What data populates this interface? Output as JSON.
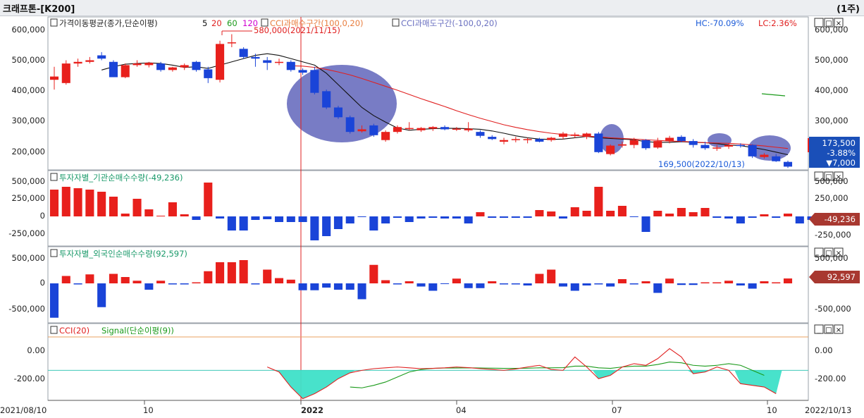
{
  "window": {
    "title": "크래프톤-[K200]",
    "period": "(1주)",
    "pane_buttons": [
      "_",
      "□",
      "×"
    ]
  },
  "price_pane": {
    "legend_prefix": "가격이동평균(종가,단순이평)",
    "ma_periods": [
      "5",
      "20",
      "60",
      "120"
    ],
    "ma_colors": [
      "#111111",
      "#e02020",
      "#1a9a1a",
      "#d000d0"
    ],
    "legend_cci_over": "CCI과매수구간(100,0,20)",
    "legend_cci_under": "CCI과매도구간(-100,0,20)",
    "hc_label": "HC:-70.09%",
    "lc_label": "LC:2.36%",
    "high_annotation": "580,000(2021/11/15)",
    "low_annotation": "169,500(2022/10/13)",
    "y_labels": [
      "600,000",
      "500,000",
      "400,000",
      "300,000",
      "200,000"
    ],
    "right_y_labels": [
      "600,000",
      "500,000",
      "400,000",
      "300,000",
      "200,000"
    ],
    "current_price": "173,500",
    "change_pct": "-3.88%",
    "change_amount": "▼7,000"
  },
  "inst_pane": {
    "legend": "투자자별_기관순매수수량(-49,236)",
    "y_labels": [
      "500,000",
      "250,000",
      "0",
      "-250,000"
    ],
    "right_y_labels": [
      "500,000",
      "250,000",
      "0",
      "-250,000"
    ],
    "current_value": "-49,236"
  },
  "foreign_pane": {
    "legend": "투자자별_외국인순매수수량(92,597)",
    "y_labels": [
      "500,000",
      "0",
      "-500,000"
    ],
    "right_y_labels": [
      "500,000",
      "0",
      "-500,000"
    ],
    "current_value": "92,597"
  },
  "cci_pane": {
    "legend_cci": "CCI(20)",
    "legend_signal": "Signal(단순이평(9))",
    "y_labels": [
      "0.00",
      "-200.00"
    ],
    "right_y_labels": [
      "0.00",
      "-200.00"
    ]
  },
  "x_axis": {
    "labels": [
      "2021/08/10",
      "10",
      "2022",
      "04",
      "07",
      "10",
      "2022/10/13"
    ]
  },
  "colors": {
    "up": "#e8201c",
    "down": "#1a44d8",
    "ma20": "#e02020",
    "ma5": "#111111",
    "cci": "#e02020",
    "signal": "#1a9a1a",
    "cci_fill": "#3ee0c8",
    "highlight_ellipse": "#5a5fb8",
    "cursor_line": "#e02020"
  },
  "chart_data": [
    {
      "type": "candlestick",
      "title": "크래프톤-[K200]",
      "x_label": "week",
      "ylim": [
        170000,
        620000
      ],
      "candles": [
        {
          "o": 440000,
          "h": 480000,
          "l": 410000,
          "c": 450000
        },
        {
          "o": 430000,
          "h": 500000,
          "l": 425000,
          "c": 490000
        },
        {
          "o": 490000,
          "h": 505000,
          "l": 480000,
          "c": 495000
        },
        {
          "o": 495000,
          "h": 510000,
          "l": 490000,
          "c": 500000
        },
        {
          "o": 515000,
          "h": 525000,
          "l": 500000,
          "c": 505000
        },
        {
          "o": 495000,
          "h": 500000,
          "l": 450000,
          "c": 448000
        },
        {
          "o": 448000,
          "h": 490000,
          "l": 445000,
          "c": 485000
        },
        {
          "o": 485000,
          "h": 500000,
          "l": 480000,
          "c": 490000
        },
        {
          "o": 485000,
          "h": 495000,
          "l": 478000,
          "c": 492000
        },
        {
          "o": 490000,
          "h": 495000,
          "l": 465000,
          "c": 470000
        },
        {
          "o": 470000,
          "h": 480000,
          "l": 465000,
          "c": 478000
        },
        {
          "o": 478000,
          "h": 490000,
          "l": 470000,
          "c": 485000
        },
        {
          "o": 495000,
          "h": 498000,
          "l": 465000,
          "c": 470000
        },
        {
          "o": 472000,
          "h": 480000,
          "l": 430000,
          "c": 445000
        },
        {
          "o": 440000,
          "h": 560000,
          "l": 432000,
          "c": 550000
        },
        {
          "o": 555000,
          "h": 580000,
          "l": 540000,
          "c": 555000
        },
        {
          "o": 535000,
          "h": 540000,
          "l": 505000,
          "c": 510000
        },
        {
          "o": 510000,
          "h": 520000,
          "l": 480000,
          "c": 505000
        },
        {
          "o": 500000,
          "h": 510000,
          "l": 470000,
          "c": 492000
        },
        {
          "o": 492000,
          "h": 505000,
          "l": 485000,
          "c": 495000
        },
        {
          "o": 495000,
          "h": 500000,
          "l": 465000,
          "c": 470000
        },
        {
          "o": 470000,
          "h": 475000,
          "l": 455000,
          "c": 462000
        },
        {
          "o": 470000,
          "h": 480000,
          "l": 395000,
          "c": 400000
        },
        {
          "o": 405000,
          "h": 410000,
          "l": 350000,
          "c": 355000
        },
        {
          "o": 355000,
          "h": 360000,
          "l": 320000,
          "c": 325000
        },
        {
          "o": 325000,
          "h": 330000,
          "l": 275000,
          "c": 280000
        },
        {
          "o": 282000,
          "h": 300000,
          "l": 278000,
          "c": 288000
        },
        {
          "o": 300000,
          "h": 305000,
          "l": 265000,
          "c": 270000
        },
        {
          "o": 255000,
          "h": 285000,
          "l": 250000,
          "c": 280000
        },
        {
          "o": 280000,
          "h": 300000,
          "l": 275000,
          "c": 295000
        },
        {
          "o": 290000,
          "h": 310000,
          "l": 285000,
          "c": 292000
        },
        {
          "o": 285000,
          "h": 295000,
          "l": 280000,
          "c": 292000
        },
        {
          "o": 290000,
          "h": 298000,
          "l": 283000,
          "c": 295000
        },
        {
          "o": 295000,
          "h": 300000,
          "l": 285000,
          "c": 288000
        },
        {
          "o": 288000,
          "h": 295000,
          "l": 283000,
          "c": 290000
        },
        {
          "o": 285000,
          "h": 310000,
          "l": 280000,
          "c": 290000
        },
        {
          "o": 280000,
          "h": 285000,
          "l": 262000,
          "c": 268000
        },
        {
          "o": 265000,
          "h": 270000,
          "l": 255000,
          "c": 258000
        },
        {
          "o": 250000,
          "h": 262000,
          "l": 242000,
          "c": 255000
        },
        {
          "o": 255000,
          "h": 265000,
          "l": 248000,
          "c": 258000
        },
        {
          "o": 255000,
          "h": 262000,
          "l": 245000,
          "c": 258000
        },
        {
          "o": 258000,
          "h": 262000,
          "l": 248000,
          "c": 250000
        },
        {
          "o": 255000,
          "h": 265000,
          "l": 250000,
          "c": 262000
        },
        {
          "o": 265000,
          "h": 280000,
          "l": 258000,
          "c": 275000
        },
        {
          "o": 268000,
          "h": 278000,
          "l": 262000,
          "c": 272000
        },
        {
          "o": 265000,
          "h": 278000,
          "l": 258000,
          "c": 275000
        },
        {
          "o": 275000,
          "h": 280000,
          "l": 215000,
          "c": 218000
        },
        {
          "o": 212000,
          "h": 242000,
          "l": 208000,
          "c": 238000
        },
        {
          "o": 238000,
          "h": 250000,
          "l": 232000,
          "c": 242000
        },
        {
          "o": 240000,
          "h": 262000,
          "l": 230000,
          "c": 255000
        },
        {
          "o": 255000,
          "h": 258000,
          "l": 225000,
          "c": 230000
        },
        {
          "o": 232000,
          "h": 262000,
          "l": 228000,
          "c": 252000
        },
        {
          "o": 252000,
          "h": 268000,
          "l": 245000,
          "c": 262000
        },
        {
          "o": 265000,
          "h": 270000,
          "l": 248000,
          "c": 252000
        },
        {
          "o": 252000,
          "h": 258000,
          "l": 232000,
          "c": 240000
        },
        {
          "o": 240000,
          "h": 250000,
          "l": 225000,
          "c": 230000
        },
        {
          "o": 230000,
          "h": 240000,
          "l": 222000,
          "c": 232000
        },
        {
          "o": 235000,
          "h": 245000,
          "l": 228000,
          "c": 240000
        },
        {
          "o": 240000,
          "h": 245000,
          "l": 232000,
          "c": 238000
        },
        {
          "o": 240000,
          "h": 242000,
          "l": 200000,
          "c": 205000
        },
        {
          "o": 203000,
          "h": 215000,
          "l": 198000,
          "c": 210000
        },
        {
          "o": 205000,
          "h": 212000,
          "l": 188000,
          "c": 190000
        },
        {
          "o": 188000,
          "h": 192000,
          "l": 169500,
          "c": 173500
        }
      ],
      "series": [
        {
          "name": "5",
          "values": [
            null,
            null,
            null,
            null,
            470000,
            480000,
            488000,
            490000,
            492000,
            490000,
            485000,
            478000,
            480000,
            475000,
            485000,
            495000,
            505000,
            515000,
            520000,
            515000,
            505000,
            495000,
            485000,
            460000,
            425000,
            390000,
            355000,
            330000,
            310000,
            292000,
            285000,
            288000,
            290000,
            291000,
            291000,
            290000,
            288000,
            283000,
            276000,
            268000,
            262000,
            258000,
            257000,
            258000,
            262000,
            266000,
            262000,
            260000,
            258000,
            256000,
            250000,
            248000,
            248000,
            250000,
            248000,
            247000,
            244000,
            240000,
            238000,
            232000,
            226000,
            218000,
            210000
          ]
        },
        {
          "name": "20",
          "values": [
            null,
            null,
            null,
            null,
            null,
            null,
            null,
            null,
            null,
            null,
            null,
            null,
            null,
            null,
            null,
            null,
            null,
            null,
            null,
            null,
            483000,
            482000,
            478000,
            472000,
            464000,
            455000,
            444000,
            432000,
            420000,
            408000,
            395000,
            382000,
            370000,
            358000,
            345000,
            333000,
            322000,
            312000,
            302000,
            294000,
            287000,
            281000,
            276000,
            272000,
            269000,
            267000,
            265000,
            262000,
            260000,
            258000,
            256000,
            254000,
            252000,
            251000,
            249000,
            247000,
            246000,
            245000,
            243000,
            240000,
            237000,
            233000,
            229000
          ]
        }
      ],
      "annotations": [
        "580,000(2021/11/15)",
        "169,500(2022/10/13)",
        "HC:-70.09%",
        "LC:2.36%"
      ]
    },
    {
      "type": "bar",
      "title": "투자자별_기관순매수수량(-49,236)",
      "ylim": [
        -350000,
        600000
      ],
      "values": [
        380000,
        420000,
        400000,
        380000,
        350000,
        280000,
        40000,
        250000,
        100000,
        10000,
        200000,
        30000,
        -50000,
        480000,
        -30000,
        -200000,
        -200000,
        -50000,
        -40000,
        -80000,
        -80000,
        -80000,
        -340000,
        -280000,
        -180000,
        -100000,
        -10000,
        -200000,
        -100000,
        -20000,
        -80000,
        -30000,
        -20000,
        -30000,
        -30000,
        -100000,
        60000,
        -20000,
        -20000,
        -20000,
        -20000,
        90000,
        70000,
        -30000,
        130000,
        80000,
        420000,
        80000,
        150000,
        -10000,
        -220000,
        80000,
        40000,
        120000,
        60000,
        120000,
        -20000,
        -30000,
        -100000,
        -20000,
        30000,
        -20000,
        40000,
        -100000,
        -49236
      ]
    },
    {
      "type": "bar",
      "title": "투자자별_외국인순매수수량(92,597)",
      "ylim": [
        -700000,
        600000
      ],
      "values": [
        -650000,
        140000,
        -20000,
        170000,
        -450000,
        180000,
        120000,
        50000,
        -120000,
        50000,
        -20000,
        -20000,
        20000,
        230000,
        400000,
        400000,
        440000,
        -20000,
        260000,
        100000,
        70000,
        -130000,
        -130000,
        -80000,
        -120000,
        -120000,
        -300000,
        350000,
        60000,
        -20000,
        40000,
        -60000,
        -140000,
        -10000,
        90000,
        -90000,
        -90000,
        40000,
        -20000,
        -20000,
        -40000,
        180000,
        260000,
        -60000,
        -140000,
        -40000,
        -20000,
        -60000,
        80000,
        -20000,
        40000,
        -180000,
        90000,
        -30000,
        -30000,
        20000,
        20000,
        50000,
        -40000,
        -100000,
        40000,
        20000,
        92597
      ]
    },
    {
      "type": "line",
      "title": "CCI(20) Signal(단순이평(9))",
      "ylim": [
        -280,
        100
      ],
      "reference_lines": [
        100,
        -100
      ],
      "series": [
        {
          "name": "CCI(20)",
          "values": [
            null,
            null,
            null,
            null,
            null,
            null,
            null,
            null,
            null,
            null,
            null,
            null,
            null,
            null,
            null,
            null,
            null,
            null,
            -80,
            -110,
            -200,
            -270,
            -240,
            -200,
            -150,
            -115,
            -100,
            -90,
            -85,
            -80,
            -85,
            -90,
            -88,
            -85,
            -80,
            -84,
            -90,
            -95,
            -100,
            -92,
            -80,
            -70,
            -95,
            -100,
            -20,
            -80,
            -150,
            -130,
            -80,
            -60,
            -70,
            -30,
            30,
            -20,
            -120,
            -110,
            -80,
            -100,
            -180,
            -190,
            -200,
            -240
          ]
        },
        {
          "name": "Signal(단순이평(9))",
          "values": [
            null,
            null,
            null,
            null,
            null,
            null,
            null,
            null,
            null,
            null,
            null,
            null,
            null,
            null,
            null,
            null,
            null,
            null,
            null,
            null,
            null,
            null,
            null,
            null,
            null,
            -200,
            -205,
            -190,
            -170,
            -140,
            -110,
            -95,
            -88,
            -86,
            -86,
            -85,
            -86,
            -87,
            -88,
            -88,
            -87,
            -85,
            -85,
            -84,
            -75,
            -75,
            -85,
            -88,
            -80,
            -75,
            -75,
            -65,
            -50,
            -55,
            -70,
            -75,
            -70,
            -60,
            -70,
            -100,
            -130
          ]
        }
      ]
    }
  ]
}
